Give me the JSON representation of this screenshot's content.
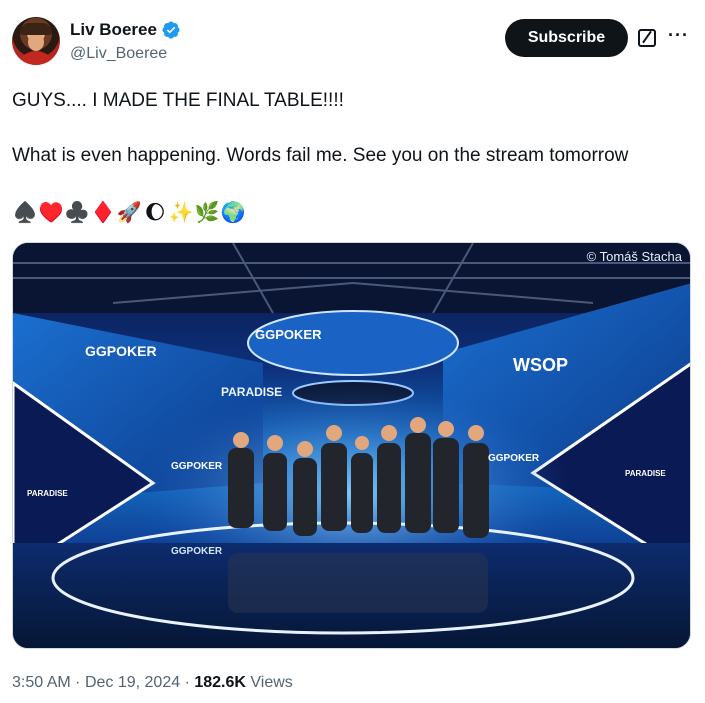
{
  "author": {
    "name": "Liv Boeree",
    "handle": "@Liv_Boeree",
    "verified_color": "#1d9bf0"
  },
  "actions": {
    "subscribe_label": "Subscribe",
    "grok_icon": "slash-box-icon",
    "more_icon": "more-dots-icon"
  },
  "tweet": {
    "line1": "GUYS.... I MADE THE FINAL TABLE!!!!",
    "line2": "What is even happening. Words fail me. See you on the stream tomorrow",
    "emojis": [
      "♠️",
      "♥️",
      "♣️",
      "♦️",
      "🚀",
      "🌔",
      "✨",
      "🌿",
      "🌍"
    ]
  },
  "photo": {
    "credit": "© Tomáš Stacha",
    "signs": [
      "GGPOKER",
      "GGPOKER",
      "WSOP",
      "PARADISE",
      "GGPOKER",
      "GGPOKER",
      "GGPOKER",
      "PARADISE",
      "PARADISE"
    ]
  },
  "meta": {
    "time": "3:50 AM",
    "date": "Dec 19, 2024",
    "views_count": "182.6K",
    "views_label": "Views"
  }
}
